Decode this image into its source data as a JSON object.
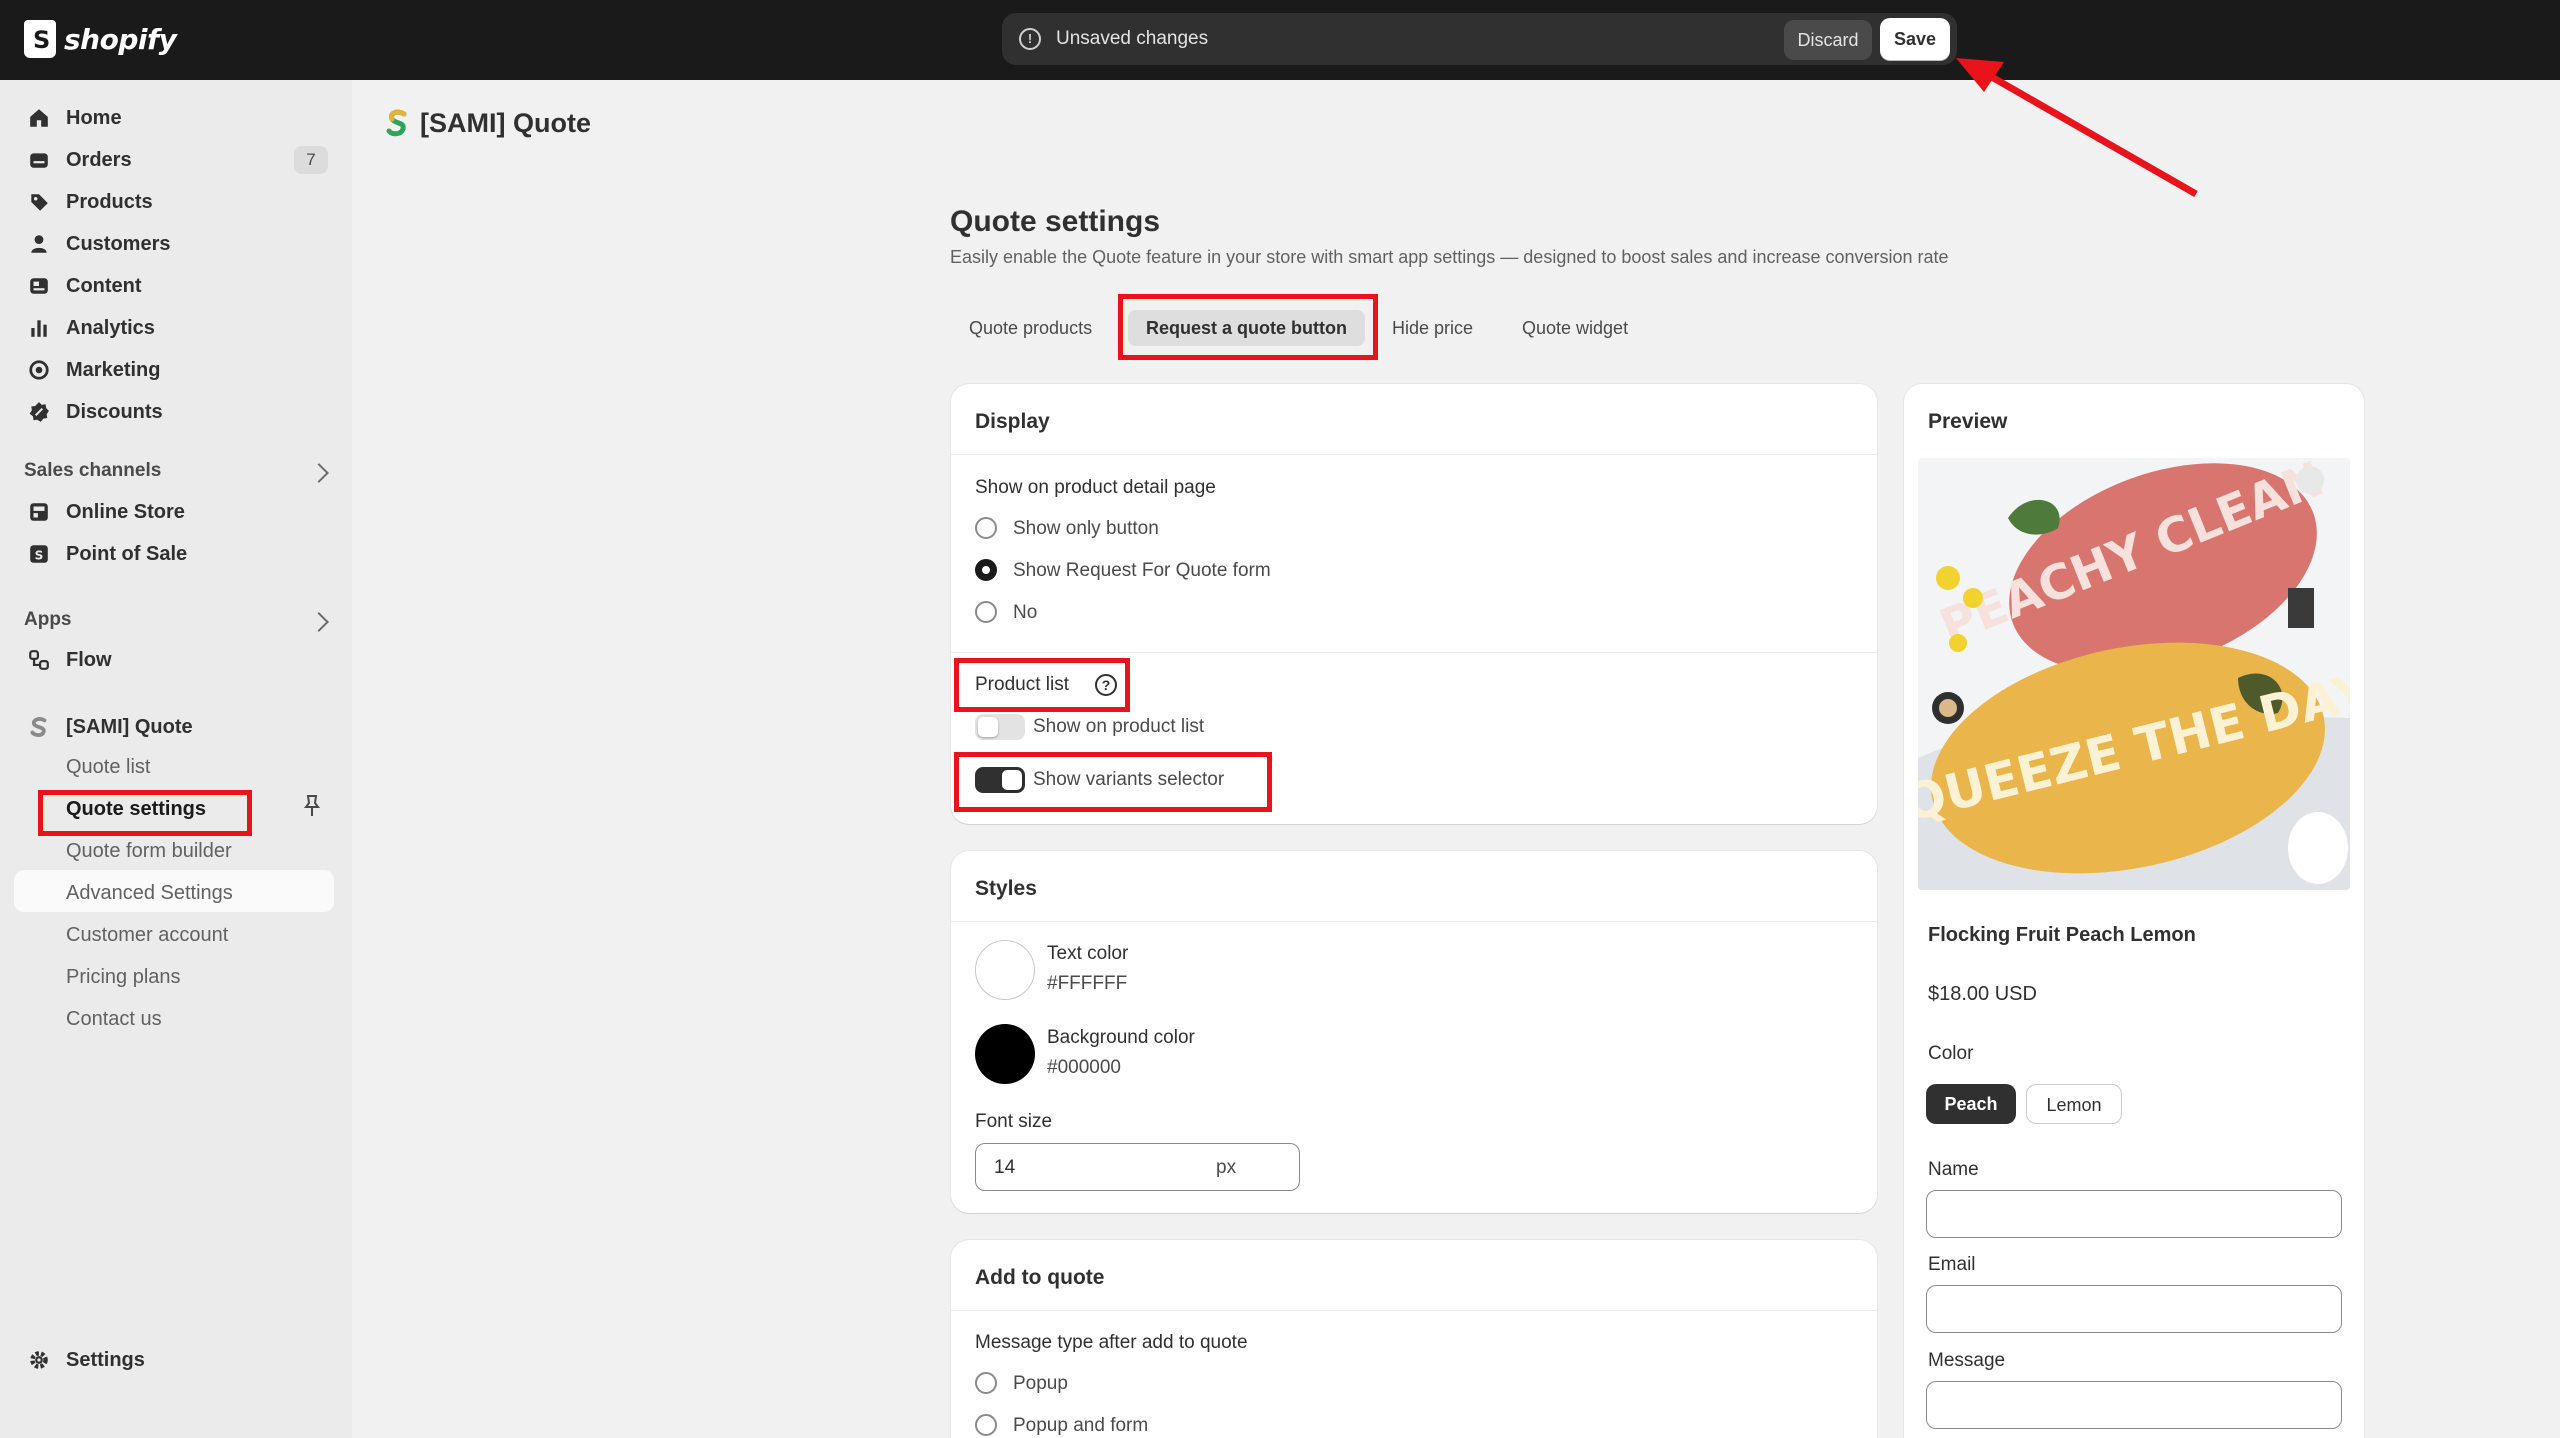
{
  "topbar": {
    "brand": "shopify",
    "unsaved_label": "Unsaved changes",
    "discard_label": "Discard",
    "save_label": "Save"
  },
  "sidebar": {
    "nav": [
      {
        "label": "Home",
        "icon": "home-icon"
      },
      {
        "label": "Orders",
        "icon": "orders-icon",
        "badge": "7"
      },
      {
        "label": "Products",
        "icon": "tag-icon"
      },
      {
        "label": "Customers",
        "icon": "person-icon"
      },
      {
        "label": "Content",
        "icon": "content-icon"
      },
      {
        "label": "Analytics",
        "icon": "bar-chart-icon"
      },
      {
        "label": "Marketing",
        "icon": "target-icon"
      },
      {
        "label": "Discounts",
        "icon": "discount-icon"
      }
    ],
    "sales_channels_label": "Sales channels",
    "channels": [
      {
        "label": "Online Store",
        "icon": "store-icon"
      },
      {
        "label": "Point of Sale",
        "icon": "pos-icon"
      }
    ],
    "apps_label": "Apps",
    "apps": [
      {
        "label": "Flow",
        "icon": "flow-icon"
      }
    ],
    "app_name": "[SAMI] Quote",
    "app_sub": [
      "Quote list",
      "Quote settings",
      "Quote form builder",
      "Advanced Settings",
      "Customer account",
      "Pricing plans",
      "Contact us"
    ],
    "settings_label": "Settings"
  },
  "header": {
    "app_title": "[SAMI] Quote"
  },
  "page": {
    "title": "Quote settings",
    "subtitle": "Easily enable the Quote feature in your store with smart app settings — designed to boost sales and increase conversion rate",
    "tabs": [
      "Quote products",
      "Request a quote button",
      "Hide price",
      "Quote widget"
    ],
    "active_tab": "Request a quote button"
  },
  "display": {
    "title": "Display",
    "detail_label": "Show on product detail page",
    "options": [
      "Show only button",
      "Show Request For Quote form",
      "No"
    ],
    "selected": "Show Request For Quote form",
    "product_list_label": "Product list",
    "toggle_product_list": "Show on product list",
    "toggle_product_list_on": false,
    "toggle_variants": "Show variants selector",
    "toggle_variants_on": true
  },
  "styles": {
    "title": "Styles",
    "text_color_label": "Text color",
    "text_color_value": "#FFFFFF",
    "bg_color_label": "Background color",
    "bg_color_value": "#000000",
    "font_size_label": "Font size",
    "font_size_value": "14",
    "font_size_unit": "px"
  },
  "add_to_quote": {
    "title": "Add to quote",
    "message_label": "Message type after add to quote",
    "options": [
      "Popup",
      "Popup and form"
    ]
  },
  "preview": {
    "title": "Preview",
    "product_name": "Flocking Fruit Peach Lemon",
    "price": "$18.00 USD",
    "color_label": "Color",
    "colors": [
      "Peach",
      "Lemon"
    ],
    "selected_color": "Peach",
    "fields": [
      "Name",
      "Email",
      "Message"
    ],
    "image_text_1": "PEACHY CLEAN",
    "image_text_2": "SQUEEZE THE DAY"
  },
  "colors": {
    "topbar": "#1a1a1a",
    "annotation_red": "#e8131b",
    "peach_mat": "#d9756f",
    "lemon_mat": "#eab54a"
  }
}
